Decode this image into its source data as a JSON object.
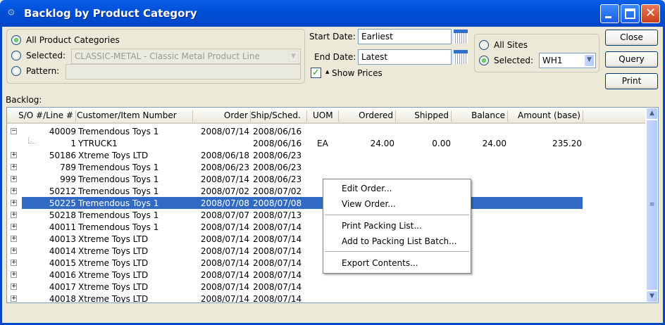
{
  "window": {
    "title": "Backlog by Product Category"
  },
  "category": {
    "all_label": "All Product Categories",
    "selected_label": "Selected:",
    "selected_value": "CLASSIC-METAL - Classic Metal Product Line",
    "pattern_label": "Pattern:",
    "pattern_value": ""
  },
  "dates": {
    "start_label": "Start Date:",
    "start_value": "Earliest",
    "end_label": "End Date:",
    "end_value": "Latest",
    "show_prices_label": "Show Prices",
    "show_prices_checked": true
  },
  "sites": {
    "all_label": "All Sites",
    "selected_label": "Selected:",
    "selected_value": "WH1"
  },
  "buttons": {
    "close": "Close",
    "query": "Query",
    "print": "Print"
  },
  "backlog": {
    "label": "Backlog:",
    "columns": [
      "S/O #/Line #",
      "Customer/Item Number",
      "Order",
      "Ship/Sched.",
      "UOM",
      "Ordered",
      "Shipped",
      "Balance",
      "Amount (base)"
    ],
    "rows": [
      [
        "40009",
        "Tremendous Toys 1",
        "2008/07/14",
        "2008/06/16",
        "",
        "",
        "",
        "",
        ""
      ],
      [
        "1",
        "YTRUCK1",
        "",
        "2008/06/16",
        "EA",
        "24.00",
        "0.00",
        "24.00",
        "235.20"
      ],
      [
        "50186",
        "Xtreme Toys LTD",
        "2008/06/18",
        "2008/06/23",
        "",
        "",
        "",
        "",
        ""
      ],
      [
        "789",
        "Tremendous Toys 1",
        "2008/06/23",
        "2008/06/23",
        "",
        "",
        "",
        "",
        ""
      ],
      [
        "999",
        "Tremendous Toys 1",
        "2008/07/14",
        "2008/06/23",
        "",
        "",
        "",
        "",
        ""
      ],
      [
        "50212",
        "Tremendous Toys 1",
        "2008/07/02",
        "2008/07/02",
        "",
        "",
        "",
        "",
        ""
      ],
      [
        "50225",
        "Tremendous Toys 1",
        "2008/07/08",
        "2008/07/08",
        "",
        "",
        "",
        "",
        ""
      ],
      [
        "50218",
        "Tremendous Toys 1",
        "2008/07/07",
        "2008/07/13",
        "",
        "",
        "",
        "",
        ""
      ],
      [
        "40011",
        "Tremendous Toys 1",
        "2008/07/14",
        "2008/07/14",
        "",
        "",
        "",
        "",
        ""
      ],
      [
        "40013",
        "Xtreme Toys LTD",
        "2008/07/14",
        "2008/07/14",
        "",
        "",
        "",
        "",
        ""
      ],
      [
        "40014",
        "Xtreme Toys LTD",
        "2008/07/14",
        "2008/07/14",
        "",
        "",
        "",
        "",
        ""
      ],
      [
        "40015",
        "Xtreme Toys LTD",
        "2008/07/14",
        "2008/07/14",
        "",
        "",
        "",
        "",
        ""
      ],
      [
        "40016",
        "Xtreme Toys LTD",
        "2008/07/14",
        "2008/07/14",
        "",
        "",
        "",
        "",
        ""
      ],
      [
        "40017",
        "Xtreme Toys LTD",
        "2008/07/14",
        "2008/07/14",
        "",
        "",
        "",
        "",
        ""
      ],
      [
        "40018",
        "Xtreme Toys LTD",
        "2008/07/14",
        "2008/07/14",
        "",
        "",
        "",
        "",
        ""
      ]
    ],
    "selected_row": 6
  },
  "context_menu": {
    "items": [
      "Edit Order...",
      "View Order...",
      "Print Packing List...",
      "Add to Packing List Batch...",
      "Export Contents..."
    ]
  }
}
